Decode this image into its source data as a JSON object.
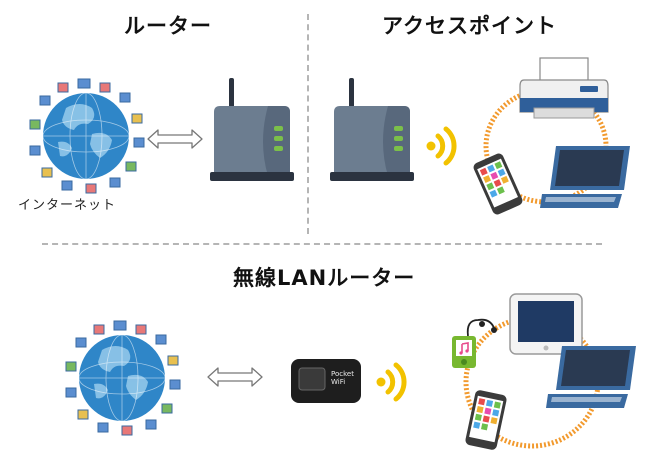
{
  "sections": {
    "router": {
      "title": "ルーター",
      "internet_label": "インターネット"
    },
    "access_point": {
      "title": "アクセスポイント"
    },
    "wireless_router": {
      "title": "無線LANルーター",
      "device_label": "Pocket WiFi"
    }
  },
  "colors": {
    "globe_ocean": "#2f86c8",
    "globe_land": "#8cc4e8",
    "router_body": "#6c7d90",
    "router_led": "#7cc04a",
    "wifi_waves": "#f2c200",
    "ring": "#f29a2e",
    "divider": "#b5b5b5",
    "laptop_body": "#3a6aa0",
    "printer_body": "#f0f0f0"
  },
  "icons": [
    "globe-icon",
    "double-arrow-icon",
    "router-icon",
    "wifi-signal-icon",
    "printer-icon",
    "smartphone-icon",
    "laptop-icon",
    "pocket-wifi-icon",
    "tablet-icon",
    "music-player-icon"
  ]
}
